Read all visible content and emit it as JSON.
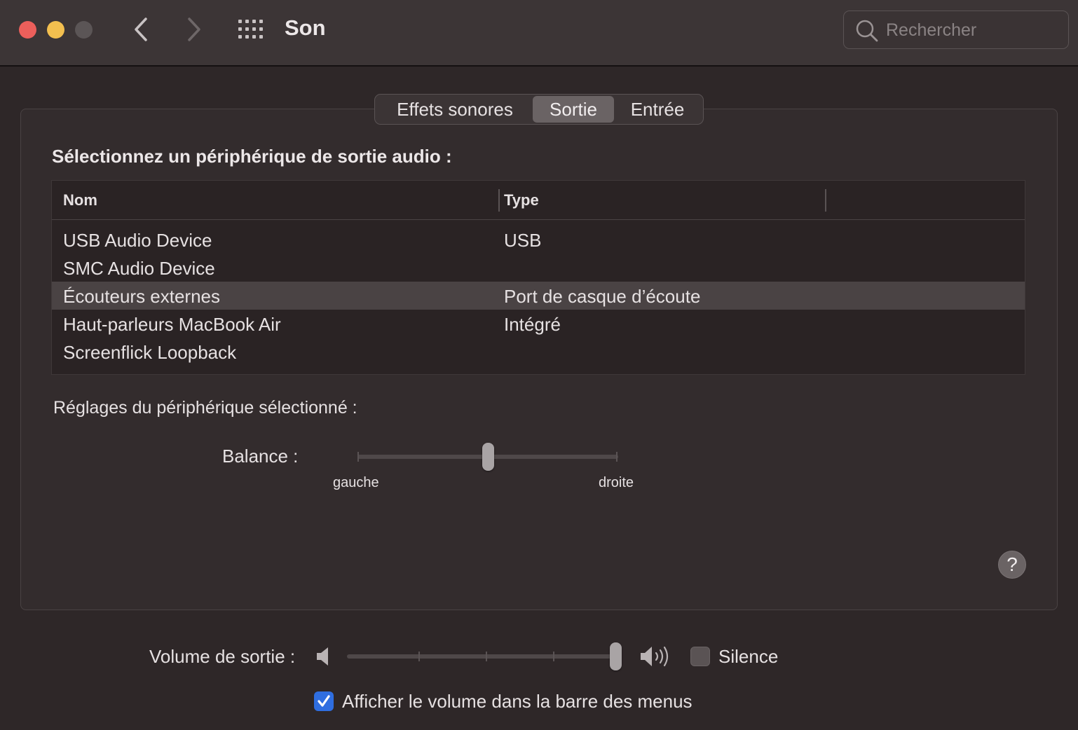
{
  "window": {
    "title": "Son",
    "search_placeholder": "Rechercher"
  },
  "tabs": [
    {
      "label": "Effets sonores",
      "selected": false
    },
    {
      "label": "Sortie",
      "selected": true
    },
    {
      "label": "Entrée",
      "selected": false
    }
  ],
  "output": {
    "section_title": "Sélectionnez un périphérique de sortie audio :",
    "columns": [
      "Nom",
      "Type"
    ],
    "devices": [
      {
        "name": "USB Audio Device",
        "type": "USB",
        "selected": false
      },
      {
        "name": "SMC Audio Device",
        "type": "",
        "selected": false
      },
      {
        "name": "Écouteurs externes",
        "type": "Port de casque d’écoute",
        "selected": true
      },
      {
        "name": "Haut-parleurs MacBook Air",
        "type": "Intégré",
        "selected": false
      },
      {
        "name": "Screenflick Loopback",
        "type": "",
        "selected": false
      }
    ],
    "settings_title": "Réglages du périphérique sélectionné :",
    "balance": {
      "label": "Balance :",
      "left_label": "gauche",
      "right_label": "droite",
      "value": 0.5
    }
  },
  "volume": {
    "label": "Volume de sortie :",
    "value": 1.0,
    "mute_label": "Silence",
    "mute_checked": false
  },
  "menu_bar": {
    "label": "Afficher le volume dans la barre des menus",
    "checked": true
  },
  "help_label": "?",
  "colors": {
    "close": "#ec5f5b",
    "minimize": "#f3bf4f",
    "zoom_disabled": "#5b5556",
    "accent": "#2f6ee0"
  }
}
